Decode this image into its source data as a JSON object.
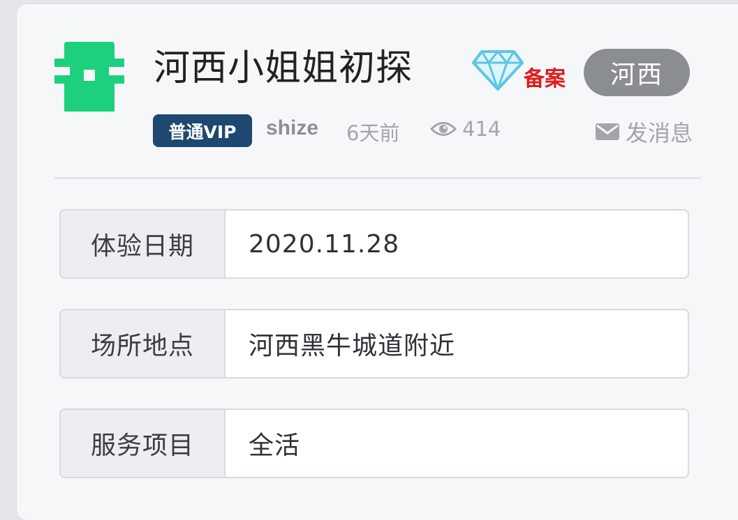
{
  "post": {
    "title": "河西小姐姐初探",
    "beian_label": "备案",
    "region_badge": "河西"
  },
  "meta": {
    "vip_label": "普通VIP",
    "author": "shize",
    "time_ago": "6天前",
    "views": "414",
    "message_label": "发消息"
  },
  "details": [
    {
      "label": "体验日期",
      "value": "2020.11.28"
    },
    {
      "label": "场所地点",
      "value": "河西黑牛城道附近"
    },
    {
      "label": "服务项目",
      "value": "全活"
    }
  ],
  "icons": {
    "logo": "site-logo",
    "diamond": "diamond-icon",
    "eye": "eye-icon",
    "mail": "envelope-icon"
  },
  "colors": {
    "logo_green": "#1dd07d",
    "beian_red": "#e21a1a",
    "vip_blue": "#1f4870",
    "badge_gray": "#8a8d92",
    "diamond_blue": "#5bc6e6"
  }
}
